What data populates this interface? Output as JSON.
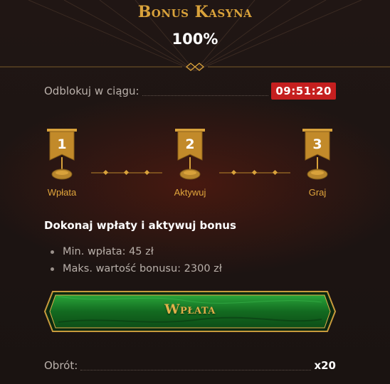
{
  "header": {
    "title": "Bonus Kasyna",
    "percent": "100%"
  },
  "unlock": {
    "label": "Odblokuj w ciągu:",
    "timer": "09:51:20"
  },
  "steps": [
    {
      "number": "1",
      "label": "Wpłata"
    },
    {
      "number": "2",
      "label": "Aktywuj"
    },
    {
      "number": "3",
      "label": "Graj"
    }
  ],
  "details": {
    "heading": "Dokonaj wpłaty i aktywuj bonus",
    "items": [
      "Min. wpłata: 45 zł",
      "Maks. wartość bonusu: 2300 zł"
    ]
  },
  "cta": {
    "label": "Wpłata"
  },
  "wager": {
    "label": "Obrót:",
    "value": "x20"
  },
  "colors": {
    "background": "#1c1412",
    "gold": "#d9a23b",
    "timer_red": "#c51f1f",
    "cta_green": "#1f8a2e"
  },
  "icons": [
    "banner-flag-icon",
    "coin-pedestal-icon",
    "divider-ornament-icon"
  ]
}
